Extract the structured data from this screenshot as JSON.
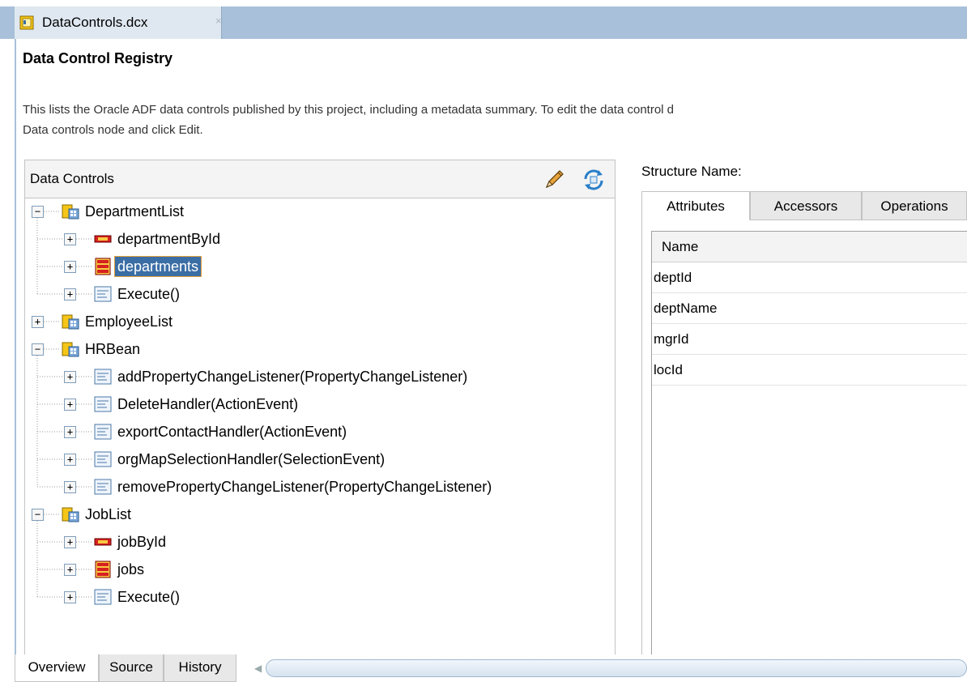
{
  "editor_tab": {
    "label": "DataControls.dcx",
    "close": "×"
  },
  "page": {
    "title": "Data Control Registry",
    "description_line1": "This lists the Oracle ADF data controls published by this project, including a metadata summary. To edit the data control d",
    "description_line2": "Data controls node and click Edit."
  },
  "data_controls": {
    "header": "Data Controls",
    "tree": [
      {
        "label": "DepartmentList",
        "icon": "data-control-icon",
        "expander": "−",
        "level": 0
      },
      {
        "label": "departmentById",
        "icon": "single-row-icon",
        "expander": "+",
        "level": 1
      },
      {
        "label": "departments",
        "icon": "collection-icon",
        "expander": "+",
        "level": 1,
        "selected": true
      },
      {
        "label": "Execute()",
        "icon": "method-icon",
        "expander": "+",
        "level": 1
      },
      {
        "label": "EmployeeList",
        "icon": "data-control-icon",
        "expander": "+",
        "level": 0
      },
      {
        "label": "HRBean",
        "icon": "data-control-icon",
        "expander": "−",
        "level": 0
      },
      {
        "label": "addPropertyChangeListener(PropertyChangeListener)",
        "icon": "method-icon",
        "expander": "+",
        "level": 1
      },
      {
        "label": "DeleteHandler(ActionEvent)",
        "icon": "method-icon",
        "expander": "+",
        "level": 1
      },
      {
        "label": "exportContactHandler(ActionEvent)",
        "icon": "method-icon",
        "expander": "+",
        "level": 1
      },
      {
        "label": "orgMapSelectionHandler(SelectionEvent)",
        "icon": "method-icon",
        "expander": "+",
        "level": 1
      },
      {
        "label": "removePropertyChangeListener(PropertyChangeListener)",
        "icon": "method-icon",
        "expander": "+",
        "level": 1
      },
      {
        "label": "JobList",
        "icon": "data-control-icon",
        "expander": "−",
        "level": 0
      },
      {
        "label": "jobById",
        "icon": "single-row-icon",
        "expander": "+",
        "level": 1
      },
      {
        "label": "jobs",
        "icon": "collection-icon",
        "expander": "+",
        "level": 1
      },
      {
        "label": "Execute()",
        "icon": "method-icon",
        "expander": "+",
        "level": 1
      }
    ]
  },
  "structure": {
    "label": "Structure Name:",
    "tabs": [
      "Attributes",
      "Accessors",
      "Operations"
    ],
    "active_tab": "Attributes",
    "column_header": "Name",
    "rows": [
      "deptId",
      "deptName",
      "mgrId",
      "locId"
    ]
  },
  "bottom_tabs": [
    "Overview",
    "Source",
    "History"
  ],
  "active_bottom_tab": "Overview",
  "colors": {
    "selection": "#3b6ea5",
    "selection_outline": "#e6a23c",
    "tab_strip": "#a8c0d9"
  }
}
